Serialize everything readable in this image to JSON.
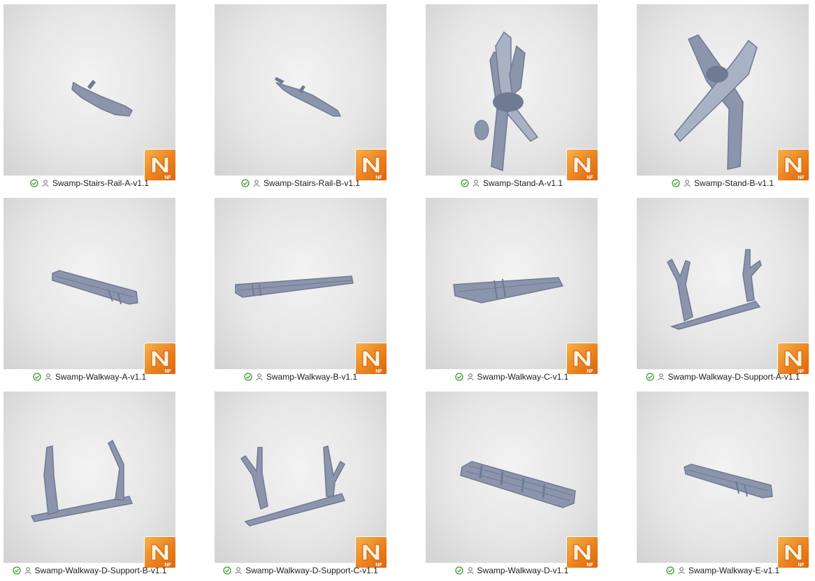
{
  "colors": {
    "sync_ok": "#3a9a2e",
    "badge_orange": "#ea7f1c",
    "model_gray": "#8b95ac",
    "background": "#ffffff"
  },
  "icons": {
    "status": "check-circle-icon",
    "owner": "person-icon",
    "app_badge": "app-n-nf-icon"
  },
  "badge_label": "NF",
  "files": [
    {
      "name": "Swamp-Stairs-Rail-A-v1.1",
      "model": "rail-a"
    },
    {
      "name": "Swamp-Stairs-Rail-B-v1.1",
      "model": "rail-b"
    },
    {
      "name": "Swamp-Stand-A-v1.1",
      "model": "stand-a"
    },
    {
      "name": "Swamp-Stand-B-v1.1",
      "model": "stand-b"
    },
    {
      "name": "Swamp-Walkway-A-v1.1",
      "model": "walkway-a"
    },
    {
      "name": "Swamp-Walkway-B-v1.1",
      "model": "walkway-b"
    },
    {
      "name": "Swamp-Walkway-C-v1.1",
      "model": "walkway-c"
    },
    {
      "name": "Swamp-Walkway-D-Support-A-v1.1",
      "model": "support-a"
    },
    {
      "name": "Swamp-Walkway-D-Support-B-v1.1",
      "model": "support-b"
    },
    {
      "name": "Swamp-Walkway-D-Support-C-v1.1",
      "model": "support-c"
    },
    {
      "name": "Swamp-Walkway-D-v1.1",
      "model": "walkway-d"
    },
    {
      "name": "Swamp-Walkway-E-v1.1",
      "model": "walkway-e"
    }
  ]
}
